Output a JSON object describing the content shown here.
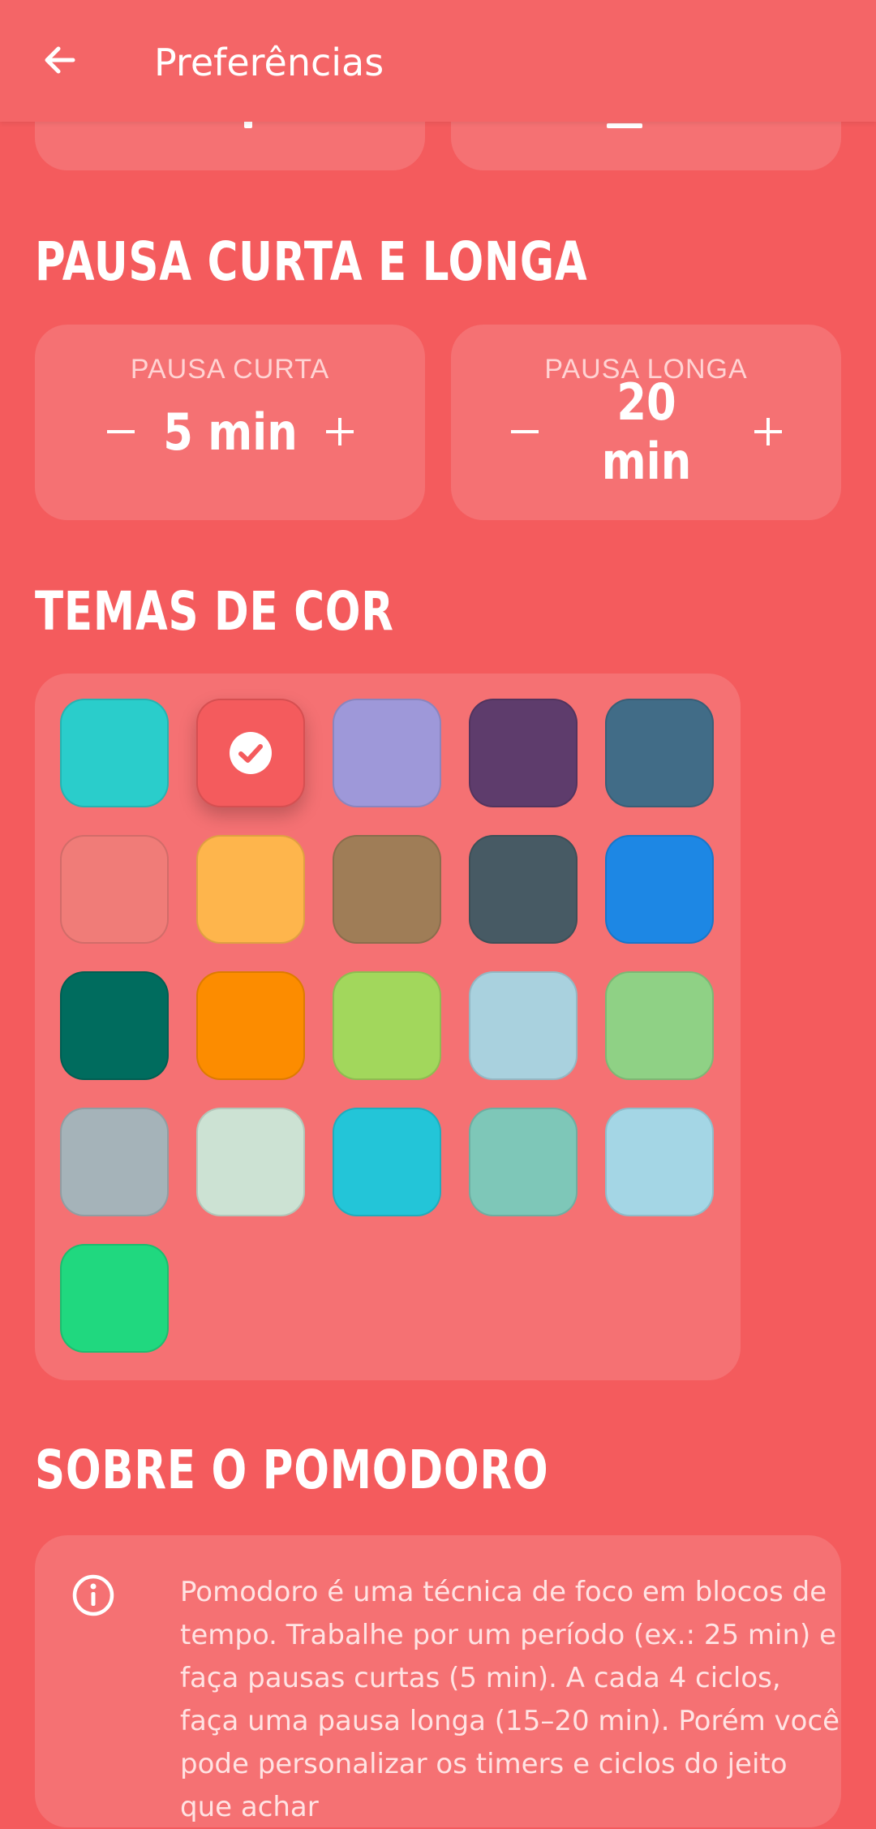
{
  "appbar": {
    "title": "Preferências",
    "back_icon": "arrow-left-icon"
  },
  "break_section": {
    "title": "PAUSA CURTA E LONGA",
    "short": {
      "label": "PAUSA CURTA",
      "value": "5 min",
      "minus": "−",
      "plus": "+"
    },
    "long": {
      "label": "PAUSA LONGA",
      "value": "20 min",
      "minus": "−",
      "plus": "+"
    }
  },
  "theme_section": {
    "title": "TEMAS DE COR",
    "selected_index": 1,
    "colors": [
      "#2ACDCB",
      "#F45B5D",
      "#9E98D9",
      "#5E3C6C",
      "#416C87",
      "#F07C78",
      "#FEB54C",
      "#9F7D57",
      "#475A64",
      "#1D87E4",
      "#006C5E",
      "#FC8C00",
      "#A2D75C",
      "#A9D1DE",
      "#8FD185",
      "#A5B3B9",
      "#CCE2D3",
      "#23C5D8",
      "#7EC7B8",
      "#A4D6E5",
      "#20D87F"
    ]
  },
  "about_section": {
    "title": "SOBRE O POMODORO",
    "info_icon": "info-icon",
    "text": "Pomodoro é uma técnica de foco em blocos de tempo. Trabalhe por um período (ex.: 25 min) e faça pausas curtas (5 min). A cada 4 ciclos, faça uma pausa longa (15–20 min). Porém você pode personalizar os timers e ciclos do jeito que achar"
  }
}
